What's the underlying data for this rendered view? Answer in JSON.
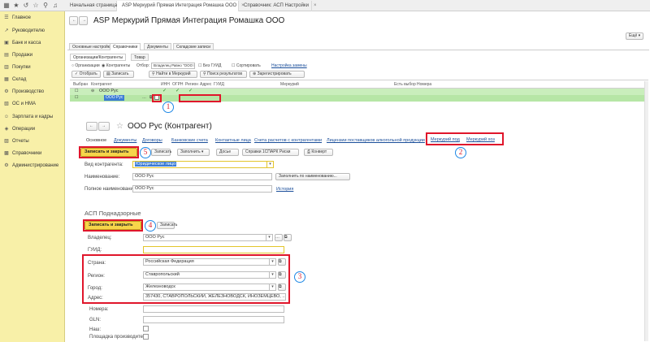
{
  "topbar": {
    "tabs": [
      {
        "label": "Начальная страница"
      },
      {
        "label": "ASP Меркурий Прямая Интеграция Ромашка ООО"
      },
      {
        "label": "Справочник: АСП Настройки"
      }
    ]
  },
  "sidebar": {
    "items": [
      {
        "label": "Главное",
        "icon": "☰"
      },
      {
        "label": "Руководителю",
        "icon": "↗"
      },
      {
        "label": "Банк и касса",
        "icon": "▣"
      },
      {
        "label": "Продажи",
        "icon": "▤"
      },
      {
        "label": "Покупки",
        "icon": "▥"
      },
      {
        "label": "Склад",
        "icon": "▦"
      },
      {
        "label": "Производство",
        "icon": "⚙"
      },
      {
        "label": "ОС и НМА",
        "icon": "▧"
      },
      {
        "label": "Зарплата и кадры",
        "icon": "☺"
      },
      {
        "label": "Операции",
        "icon": "◈"
      },
      {
        "label": "Отчеты",
        "icon": "▨"
      },
      {
        "label": "Справочники",
        "icon": "▩"
      },
      {
        "label": "Администрирование",
        "icon": "⚙"
      }
    ]
  },
  "window": {
    "title": "ASP Меркурий Прямая Интеграция Ромашка ООО",
    "more_label": "Ещё ▾",
    "tabs": [
      {
        "label": "Основные настройки"
      },
      {
        "label": "Справочники"
      },
      {
        "label": "Документы"
      },
      {
        "label": "Складские записи"
      }
    ],
    "subtabs": [
      {
        "label": "Организации/Контрагенты"
      },
      {
        "label": "Товар"
      }
    ],
    "filter": {
      "radio_org": "Организации",
      "radio_contr": "Контрагенты",
      "filter_label": "Отбор:",
      "filter_value": "Владелец Равно \"ООО Р...",
      "no_guid": "Без ГУИД",
      "sort": "Сортировать",
      "settings_link": "Настройка замены"
    },
    "actions": {
      "select": "Отобрать",
      "write": "Записать",
      "find_mercury": "Найти в Меркурий",
      "search_results": "Поиск результатов",
      "register": "Зарегистрировать"
    },
    "grid": {
      "headers": {
        "selected": "Выбран",
        "contractor": "Контрагент",
        "inn": "ИНН",
        "ogrn": "ОГРН",
        "region": "Регион",
        "address": "Адрес",
        "guid": "ГУИД",
        "mercury": "Меркурий",
        "has_choice": "Есть выбор",
        "numbers": "Номера"
      },
      "rows": [
        {
          "name": "ООО Рус"
        },
        {
          "name": "ООО Рус"
        }
      ]
    }
  },
  "card": {
    "title": "ООО Рус (Контрагент)",
    "tabs": [
      {
        "label": "Основное"
      },
      {
        "label": "Документы"
      },
      {
        "label": "Договоры"
      },
      {
        "label": "Банковские счета"
      },
      {
        "label": "Контактные лица"
      },
      {
        "label": "Счета расчетов с контрагентами"
      },
      {
        "label": "Лицензии поставщиков алкогольной продукции"
      },
      {
        "label": "Меркурий под"
      },
      {
        "label": "Меркурий хоз"
      }
    ],
    "toolbar": {
      "save_close": "Записать и закрыть",
      "write": "Записать",
      "fill": "Заполнить ▾",
      "dossier": "Досье",
      "spark": "Справки 1СПАРК Риски",
      "envelope": "Конверт"
    },
    "fields": {
      "kind_label": "Вид контрагента:",
      "kind_value": "Юридическое лицо",
      "name_label": "Наименование:",
      "name_value": "ООО Рус",
      "fill_by_name": "Заполнить по наименованию...",
      "full_name_label": "Полное наименование:",
      "full_name_value": "ООО Рус",
      "history": "История"
    }
  },
  "asp": {
    "title": "АСП Поднадзорные",
    "save_close": "Записать и закрыть",
    "write": "Записать",
    "owner_label": "Владелец:",
    "owner_value": "ООО Рус",
    "guid_label": "ГУИД:",
    "guid_value": "",
    "country_label": "Страна:",
    "country_value": "Российская Федерация",
    "region_label": "Регион:",
    "region_value": "Ставропольский",
    "city_label": "Город:",
    "city_value": "Железноводск",
    "address_label": "Адрес:",
    "address_value": "357430, СТАВРОПОЛЬСКИЙ, ЖЕЛЕЗНОВОДСК, ИНОЗЕМЦЕВО, ...",
    "numbers_label": "Номера:",
    "gln_label": "GLN:",
    "our_label": "Наш:",
    "producer_label": "Площадка производите..."
  },
  "annotations": {
    "one": "1",
    "two": "2",
    "three": "3",
    "four": "4",
    "five": "5"
  },
  "colors": {
    "sidebar": "#f8f0a8",
    "accent_yellow": "#f7d54a",
    "highlight_row": "#c9eebc",
    "annotation_red": "#e0162b",
    "annotation_blue": "#1e88e5"
  }
}
